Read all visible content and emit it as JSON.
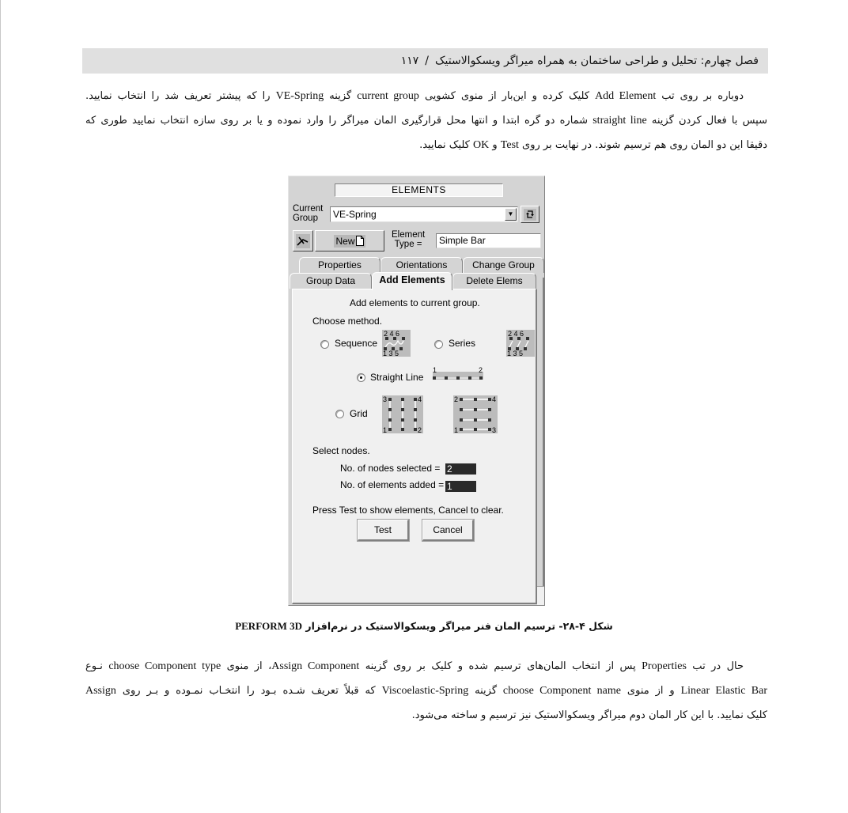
{
  "header": {
    "chapter_title": "فصل چهارم: تحلیل و طراحی ساختمان به همراه میراگر ویسکوالاستیک",
    "separator": "/",
    "page_number": "۱۱۷"
  },
  "intro_paragraph": {
    "lines": [
      [
        "دوباره  بر روی تب ",
        "Add Element",
        " کلیک کرده و این‌بار از منوی کشویی ",
        "current group",
        " گزینه ",
        "VE-Spring",
        " را که پیشتر تعریف شد را انتخاب نمایید."
      ],
      [
        "سپس با فعال کردن گزینه ",
        "straight  line",
        " شماره دو گره ابتدا و انتها محل قرارگیری المان میراگر را وارد نموده و یا بر روی سازه انتخاب نمایید طوری که"
      ],
      [
        "دقیقا این دو المان روی هم ترسیم شوند. در نهایت بر روی ",
        "Test",
        " و ",
        "OK",
        " کلیک نمایید."
      ]
    ]
  },
  "window": {
    "title": "ELEMENTS",
    "current_group_label_1": "Current",
    "current_group_label_2": "Group",
    "current_group_value": "VE-Spring",
    "dropdown_icon": "▼",
    "refresh_icon": "refresh-icon",
    "tool_icon": "pick-element-icon",
    "new_button_label": "New",
    "element_type_label_1": "Element",
    "element_type_label_2": "Type =",
    "element_type_value": "Simple Bar",
    "tabs_row1": [
      "Properties",
      "Orientations",
      "Change Group"
    ],
    "tabs_row2": [
      "Group Data",
      "Add Elements",
      "Delete Elems"
    ],
    "active_tab": "Add Elements",
    "panel": {
      "heading": "Add elements to current group.",
      "choose_method": "Choose method.",
      "methods": {
        "sequence": "Sequence",
        "series": "Series",
        "straight_line": "Straight Line",
        "grid": "Grid"
      },
      "selected_method": "Straight Line",
      "diagram_labels": {
        "seq_top": "2 4 6",
        "seq_bottom": "1 3 5",
        "line_start": "1",
        "line_end": "2",
        "grid1": [
          "3",
          "4",
          "1",
          "2"
        ],
        "grid2": [
          "2",
          "4",
          "1",
          "3"
        ]
      },
      "select_nodes": "Select nodes.",
      "nodes_selected_label": "No. of nodes selected =",
      "nodes_selected_value": "2",
      "elements_added_label": "No. of elements added =",
      "elements_added_value": "1",
      "hint": "Press Test to show elements, Cancel to clear.",
      "test_button": "Test",
      "cancel_button": "Cancel"
    }
  },
  "caption": {
    "text": "شکل ۴-۲۸- ترسیم المان فنر میراگر ویسکوالاستیک در نرم‌افزار ",
    "latin": "PERFORM 3D"
  },
  "second_paragraph": {
    "lines": [
      [
        "حال در تب ",
        "Properties",
        " پس از انتخاب المان‌های ترسیم شده و کلیک بر روی گزینه ",
        "Assign Component",
        "، از منوی ",
        "choose Component   type",
        " نـوع"
      ],
      [
        "",
        "Linear Elastic Bar",
        " و از منوی ",
        "choose Component name",
        "  گزینه ",
        "Viscoelastic-Spring",
        " که قبلاً تعریف شـده بـود را انتخـاب نمـوده و بـر روی ",
        "Assign",
        ""
      ],
      [
        "کلیک نمایید. با این کار المان دوم میراگر ویسکوالاستیک نیز ترسیم و ساخته می‌شود."
      ]
    ]
  }
}
